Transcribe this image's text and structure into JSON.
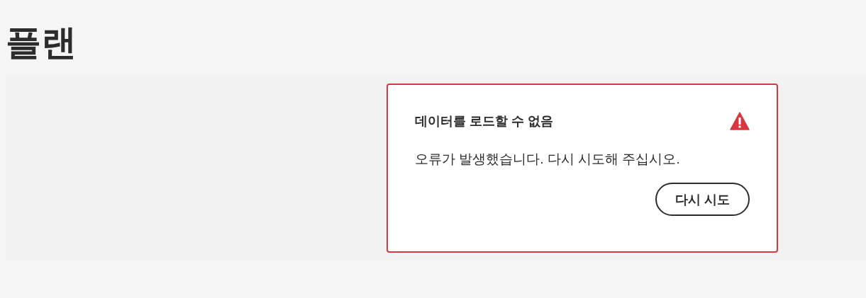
{
  "page": {
    "title": "플랜"
  },
  "error_card": {
    "heading": "데이터를 로드할 수 없음",
    "message": "오류가 발생했습니다. 다시 시도해 주십시오.",
    "button": "다시 시도"
  }
}
